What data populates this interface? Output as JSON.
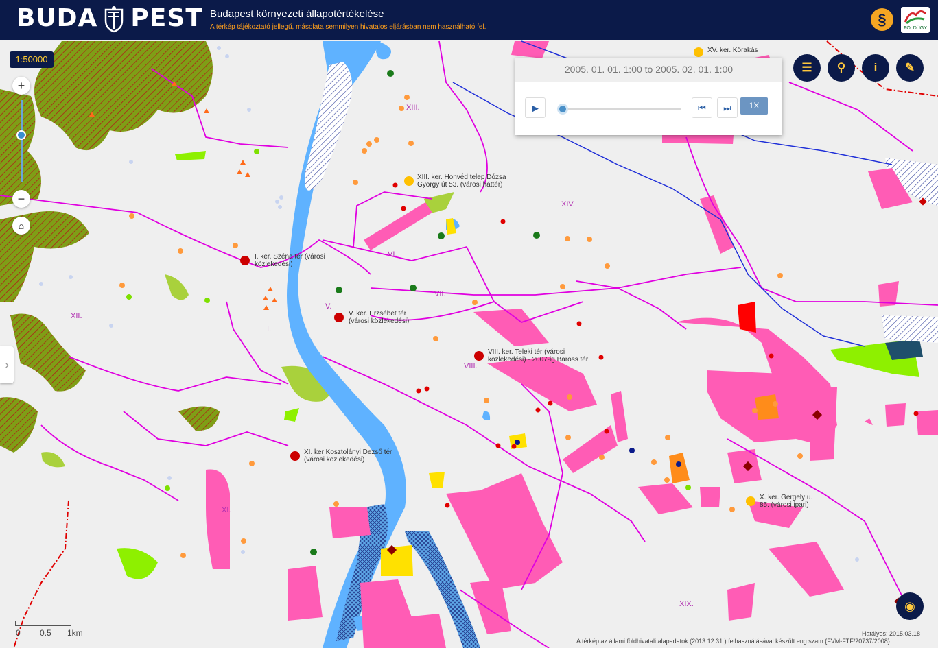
{
  "header": {
    "logo_left": "BUDA",
    "logo_right": "PEST",
    "title": "Budapest környezeti állapotértékelése",
    "subtitle": "A térkép tájékoztató jellegű, másolata semmilyen hivatalos eljárásban nem használható fel.",
    "law_symbol": "§",
    "partner_logo": "FÖLDÜGY"
  },
  "map": {
    "scale": "1:50000",
    "zoom_in": "+",
    "zoom_out": "−",
    "home": "⌂",
    "sidebar_toggle": "›"
  },
  "time_panel": {
    "range": "2005. 01. 01. 1:00 to 2005. 02. 01. 1:00",
    "play": "▶",
    "prev": "⏮",
    "next": "⏭",
    "speed": "1X",
    "slider_position": 0
  },
  "toolbar": {
    "layers": "☰",
    "search": "⚲",
    "info": "i",
    "measure": "✎",
    "visibility": "◉"
  },
  "districts": [
    "XIII.",
    "XIV.",
    "VI.",
    "VII.",
    "V.",
    "I.",
    "XII.",
    "VIII.",
    "XI.",
    "XIX."
  ],
  "stations": [
    "I. ker. Széna tér (városi közlekedési)",
    "V. ker. Erzsébet tér (városi közlekedési)",
    "XIII. ker. Honvéd telep Dózsa György út 53. (városi háttér)",
    "VIII. ker. Teleki tér (városi közlekedési) - 2007-ig Baross tér",
    "XI. ker Kosztolányi Dezső tér (városi közlekedési)",
    "X. ker. Gergely u. 85. (városi ipari)",
    "XV. ker. Kőrakás"
  ],
  "scalebar": {
    "l0": "0",
    "l1": "0.5",
    "l2": "1km"
  },
  "footer": {
    "valid": "Hatályos: 2015.03.18",
    "credit": "A térkép az állami földhivatali alapadatok (2013.12.31.) felhasználásával készült eng.szam:{FVM-FTF/20737/2008}"
  }
}
